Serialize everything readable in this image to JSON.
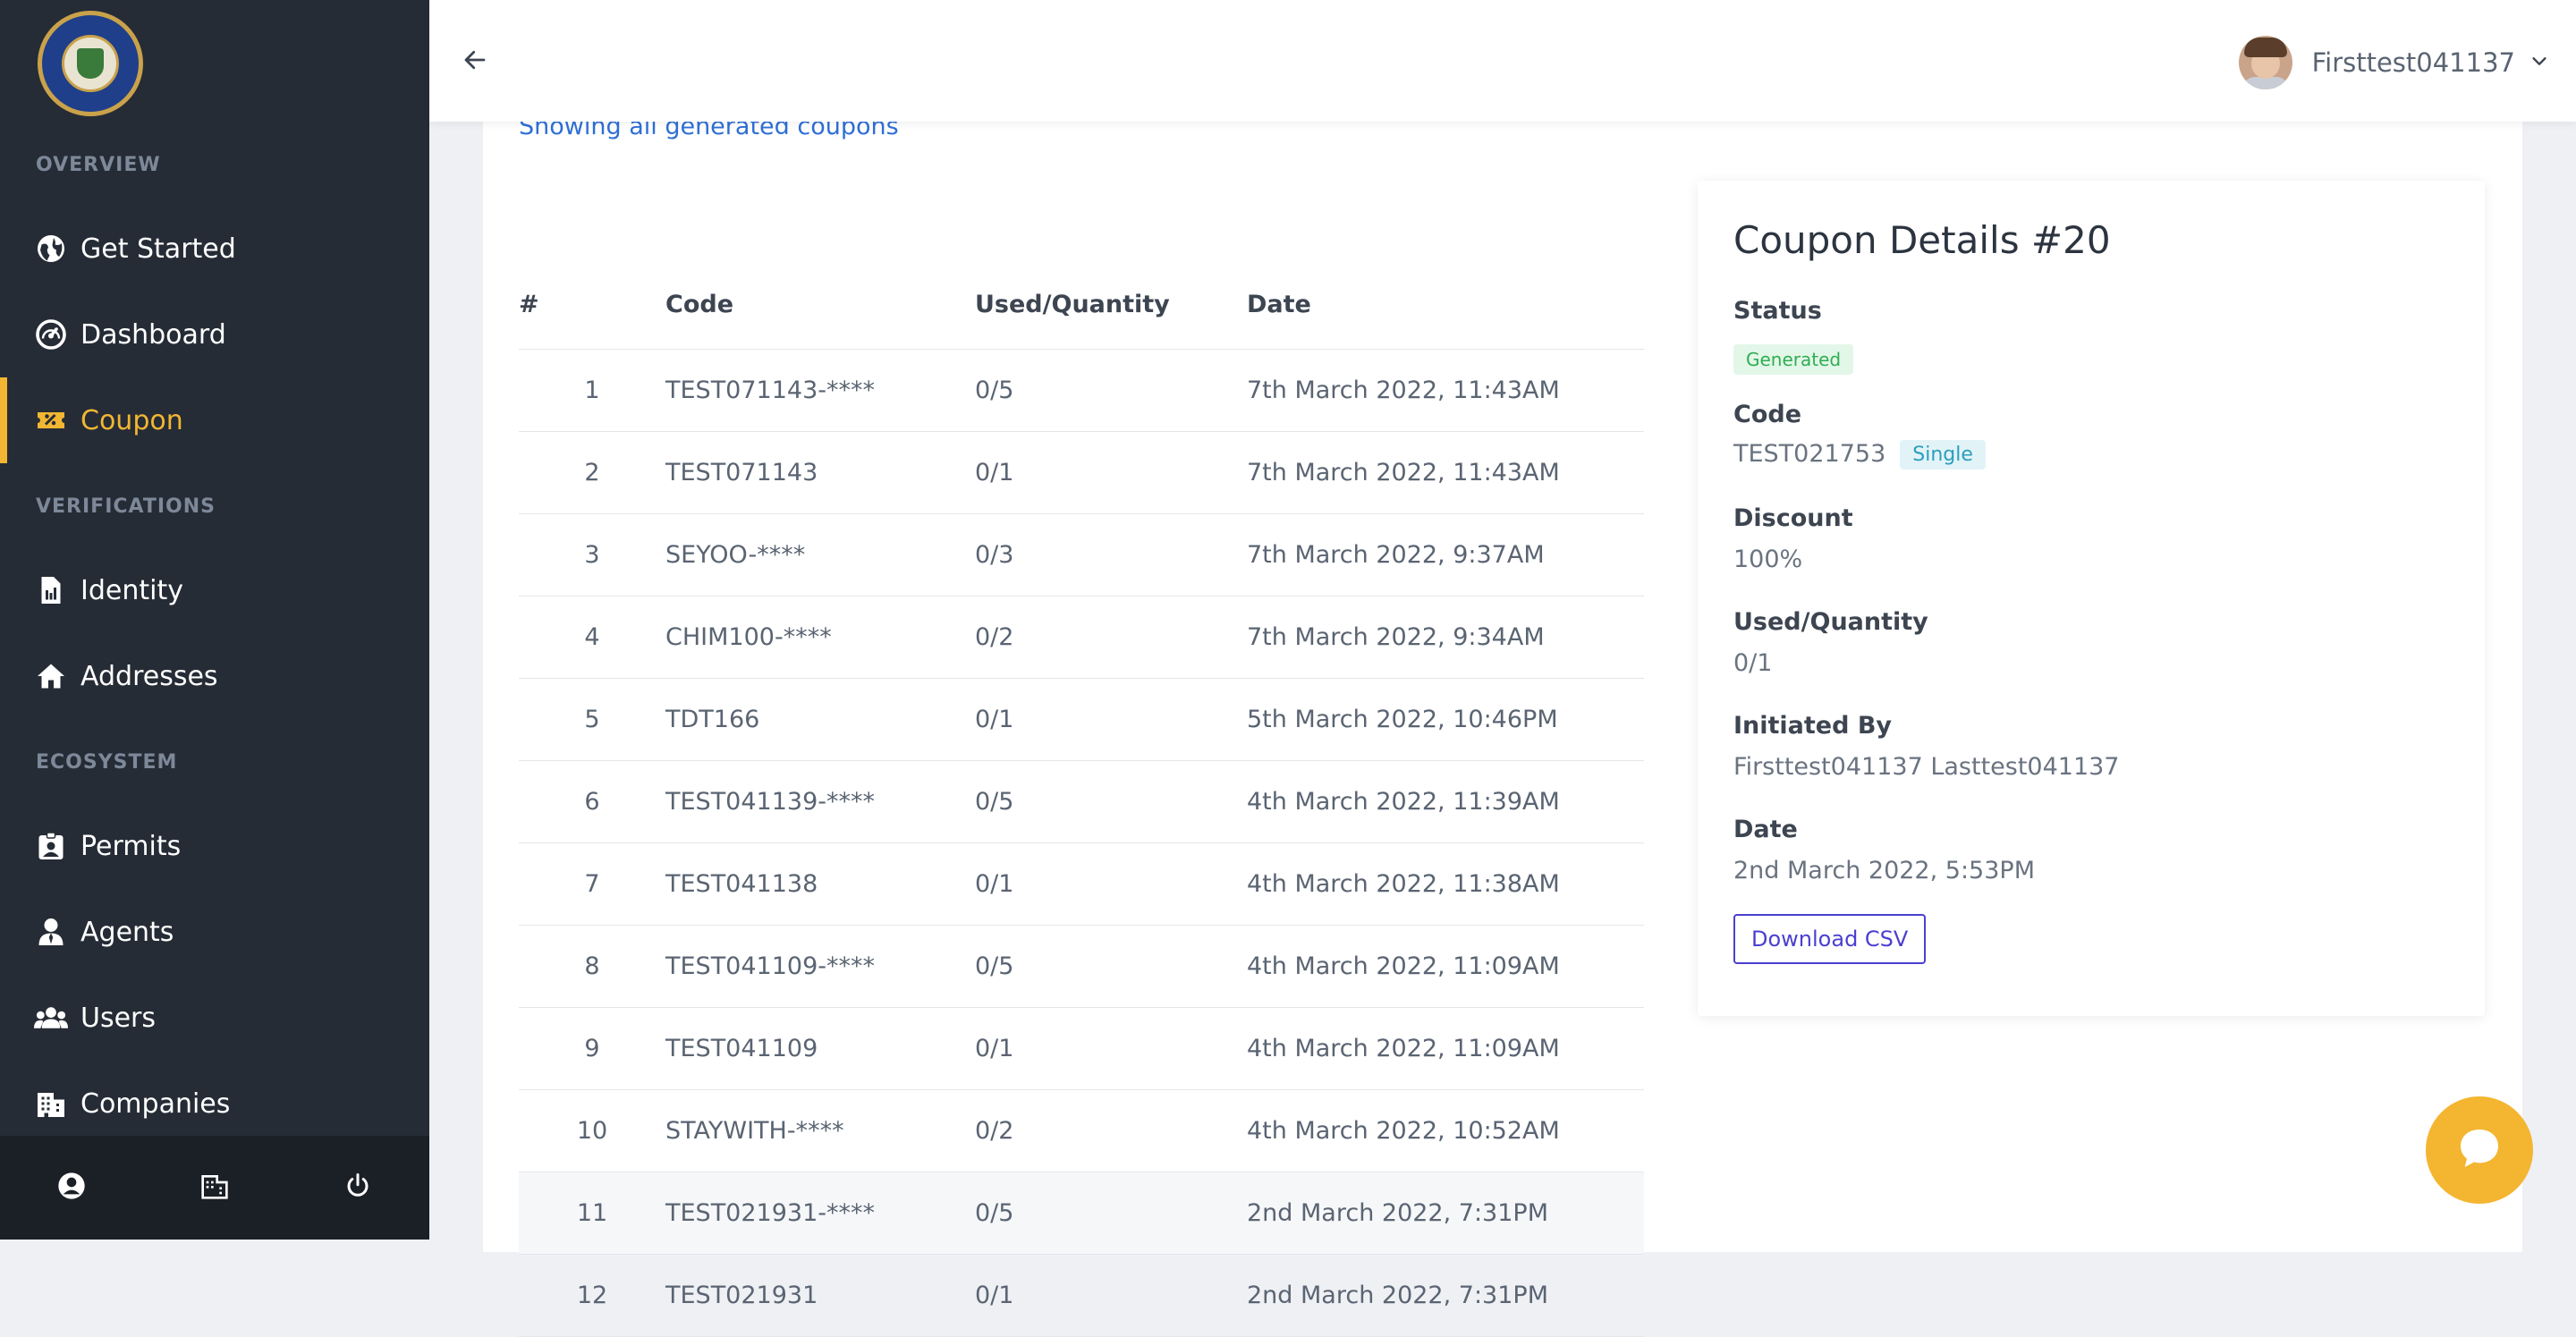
{
  "sidebar": {
    "sections": {
      "overview": "OVERVIEW",
      "verifications": "VERIFICATIONS",
      "ecosystem": "ECOSYSTEM"
    },
    "items": [
      {
        "label": "Get Started",
        "icon": "globe-icon"
      },
      {
        "label": "Dashboard",
        "icon": "speedometer-icon"
      },
      {
        "label": "Coupon",
        "icon": "ticket-icon",
        "active": true
      },
      {
        "label": "Identity",
        "icon": "id-document-icon"
      },
      {
        "label": "Addresses",
        "icon": "home-icon"
      },
      {
        "label": "Permits",
        "icon": "badge-icon"
      },
      {
        "label": "Agents",
        "icon": "agent-icon"
      },
      {
        "label": "Users",
        "icon": "users-icon"
      },
      {
        "label": "Companies",
        "icon": "building-icon"
      }
    ],
    "footer_icons": [
      "user-circle-icon",
      "building-icon",
      "power-icon"
    ]
  },
  "header": {
    "username": "Firsttest041137"
  },
  "main": {
    "subtitle": "Showing all generated coupons",
    "table": {
      "headers": [
        "#",
        "Code",
        "Used/Quantity",
        "Date"
      ],
      "rows": [
        [
          "1",
          "TEST071143-****",
          "0/5",
          "7th March 2022, 11:43AM"
        ],
        [
          "2",
          "TEST071143",
          "0/1",
          "7th March 2022, 11:43AM"
        ],
        [
          "3",
          "SEYOO-****",
          "0/3",
          "7th March 2022, 9:37AM"
        ],
        [
          "4",
          "CHIM100-****",
          "0/2",
          "7th March 2022, 9:34AM"
        ],
        [
          "5",
          "TDT166",
          "0/1",
          "5th March 2022, 10:46PM"
        ],
        [
          "6",
          "TEST041139-****",
          "0/5",
          "4th March 2022, 11:39AM"
        ],
        [
          "7",
          "TEST041138",
          "0/1",
          "4th March 2022, 11:38AM"
        ],
        [
          "8",
          "TEST041109-****",
          "0/5",
          "4th March 2022, 11:09AM"
        ],
        [
          "9",
          "TEST041109",
          "0/1",
          "4th March 2022, 11:09AM"
        ],
        [
          "10",
          "STAYWITH-****",
          "0/2",
          "4th March 2022, 10:52AM"
        ],
        [
          "11",
          "TEST021931-****",
          "0/5",
          "2nd March 2022, 7:31PM"
        ],
        [
          "12",
          "TEST021931",
          "0/1",
          "2nd March 2022, 7:31PM"
        ]
      ]
    },
    "details": {
      "title": "Coupon Details #20",
      "status_label": "Status",
      "status_value": "Generated",
      "code_label": "Code",
      "code_value": "TEST021753",
      "code_type": "Single",
      "discount_label": "Discount",
      "discount_value": "100%",
      "used_label": "Used/Quantity",
      "used_value": "0/1",
      "initiated_label": "Initiated By",
      "initiated_value": "Firsttest041137 Lasttest041137",
      "date_label": "Date",
      "date_value": "2nd March 2022, 5:53PM",
      "download_label": "Download CSV"
    }
  },
  "colors": {
    "sidebar_bg": "#262c36",
    "accent": "#f2b632",
    "link": "#2f6fd6",
    "button": "#4b3fd0"
  }
}
